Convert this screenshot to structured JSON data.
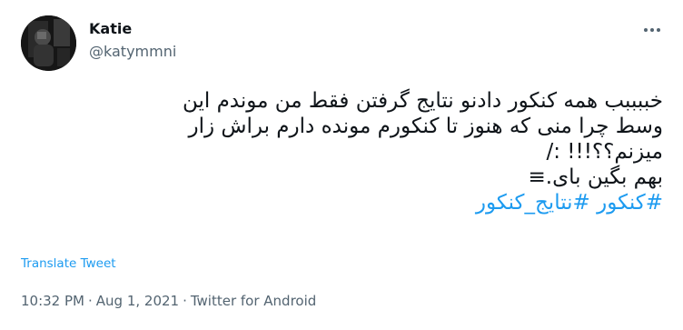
{
  "author": {
    "display_name": "Katie",
    "handle": "@katymmni",
    "avatar_icon": "profile-photo"
  },
  "menu": {
    "more_icon": "more-dots-icon"
  },
  "tweet": {
    "lines": [
      "خببببب همه کنکور دادنو نتایج گرفتن فقط من موندم این",
      "وسط چرا منی که هنوز تا کنکورم مونده دارم براش زار",
      "میزنم؟؟!!! :/",
      "بهم بگین بای.≡"
    ],
    "hashtags": [
      "#کنکور",
      "#نتایج_کنکور"
    ]
  },
  "translate": {
    "label": "Translate Tweet"
  },
  "meta": {
    "time": "10:32 PM",
    "separator": "·",
    "date": "Aug 1, 2021",
    "source": "Twitter for Android"
  },
  "colors": {
    "link": "#1d9bf0",
    "secondary_text": "#536471",
    "primary_text": "#0f1419"
  }
}
